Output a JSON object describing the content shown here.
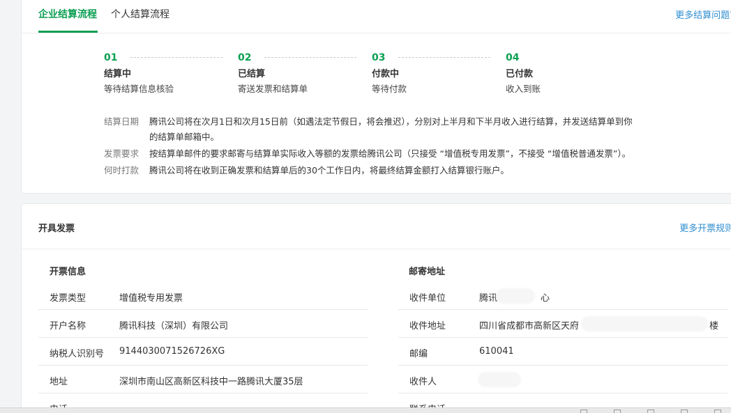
{
  "tabs": [
    {
      "label": "企业结算流程",
      "active": true
    },
    {
      "label": "个人结算流程",
      "active": false
    }
  ],
  "more_settlement_link": "更多结算问题?",
  "steps": [
    {
      "num": "01",
      "title": "结算中",
      "desc": "等待结算信息核验"
    },
    {
      "num": "02",
      "title": "已结算",
      "desc": "寄送发票和结算单"
    },
    {
      "num": "03",
      "title": "付款中",
      "desc": "等待付款"
    },
    {
      "num": "04",
      "title": "已付款",
      "desc": "收入到账"
    }
  ],
  "info": [
    {
      "label": "结算日期",
      "lines": [
        "腾讯公司将在次月1日和次月15日前（如遇法定节假日，将会推迟），分别对上半月和下半月收入进行结算，并发送结算单到你",
        "的结算单邮箱中。"
      ]
    },
    {
      "label": "发票要求",
      "lines": [
        "按结算单邮件的要求邮寄与结算单实际收入等额的发票给腾讯公司（只接受 “增值税专用发票”，不接受 “增值税普通发票”）。"
      ]
    },
    {
      "label": "何时打款",
      "lines": [
        "腾讯公司将在收到正确发票和结算单后的30个工作日内，将最终结算金额打入结算银行账户。"
      ]
    }
  ],
  "invoice_section": {
    "title": "开具发票",
    "more_rules_link": "更多开票规则?",
    "invoice_info": {
      "title": "开票信息",
      "rows": [
        {
          "key": "发票类型",
          "value": "增值税专用发票"
        },
        {
          "key": "开户名称",
          "value": "腾讯科技（深圳）有限公司"
        },
        {
          "key": "纳税人识别号",
          "value": "9144030071526726XG"
        },
        {
          "key": "地址",
          "value": "深圳市南山区高新区科技中一路腾讯大厦35层"
        },
        {
          "key": "电话",
          "value": ""
        }
      ]
    },
    "mailing_address": {
      "title": "邮寄地址",
      "rows": [
        {
          "key": "收件单位",
          "value": "腾讯",
          "value_tail": "心"
        },
        {
          "key": "收件地址",
          "value": "四川省成都市高新区天府",
          "value_tail": "楼"
        },
        {
          "key": "邮编",
          "value": "610041",
          "value_tail": ""
        },
        {
          "key": "收件人",
          "value": "",
          "value_tail": ""
        },
        {
          "key": "联系电话",
          "value": "",
          "value_tail": ""
        }
      ]
    }
  }
}
